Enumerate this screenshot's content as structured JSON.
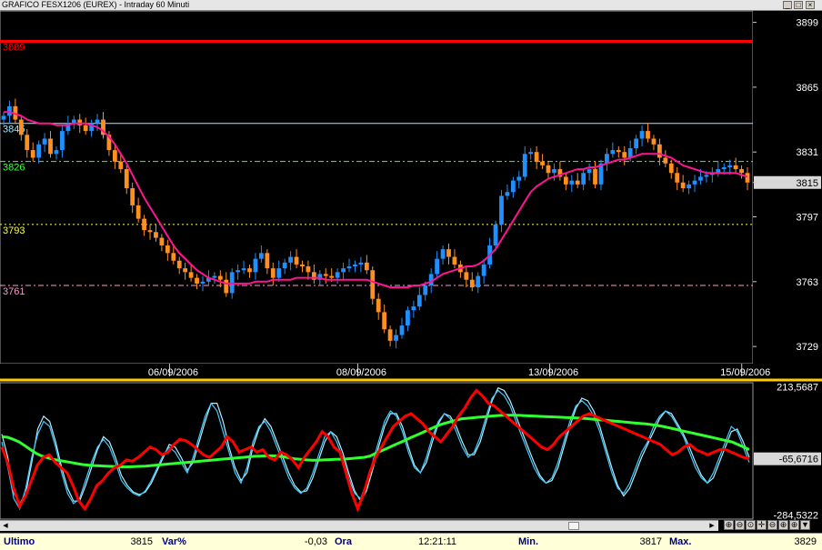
{
  "window": {
    "title": "GRAFICO FESX1206 (EUREX) - Intraday 60 Minuti",
    "controls": [
      "_",
      "□",
      "×"
    ]
  },
  "colors": {
    "background": "#000000",
    "up_candle": "#1e90ff",
    "down_candle": "#ff9020",
    "ma_line": "#ff1493",
    "resistance": "#ff0000",
    "level_cyan": "#9fe8ff",
    "level_green": "#40ff40",
    "level_yellow": "#ffff40",
    "level_pink": "#ff99cc",
    "osc_red": "#ff0000",
    "osc_green": "#30ff30",
    "osc_cyan": "#40c8ff",
    "osc_lightcyan": "#b0f0ff"
  },
  "chart_data": [
    {
      "type": "candlestick",
      "title": "",
      "ylim": [
        3720,
        3905
      ],
      "y_ticks": [
        "3899",
        "3865",
        "3831",
        "3815",
        "3797",
        "3763",
        "3729"
      ],
      "last_price_label": "3815",
      "x_labels": [
        "06/09/2006",
        "08/09/2006",
        "13/09/2006",
        "15/09/2006"
      ],
      "levels": [
        {
          "label": "3889",
          "value": 3889,
          "style": "solid",
          "color": "#ff0000"
        },
        {
          "label": "3845",
          "value": 3846,
          "style": "solid",
          "color": "#9fe8ff"
        },
        {
          "label": "3826",
          "value": 3826,
          "style": "dashdot",
          "color": "#40ff40"
        },
        {
          "label": "3793",
          "value": 3793,
          "style": "dotted",
          "color": "#ffff40"
        },
        {
          "label": "3761",
          "value": 3761,
          "style": "dashdot",
          "color": "#ff99cc"
        }
      ],
      "close": [
        3850,
        3855,
        3848,
        3840,
        3832,
        3828,
        3835,
        3838,
        3830,
        3832,
        3842,
        3846,
        3848,
        3845,
        3842,
        3846,
        3848,
        3840,
        3832,
        3826,
        3822,
        3812,
        3803,
        3796,
        3790,
        3789,
        3786,
        3782,
        3778,
        3774,
        3770,
        3768,
        3765,
        3762,
        3763,
        3765,
        3766,
        3764,
        3757,
        3768,
        3769,
        3770,
        3768,
        3775,
        3778,
        3770,
        3765,
        3770,
        3773,
        3776,
        3772,
        3771,
        3768,
        3764,
        3767,
        3766,
        3765,
        3768,
        3770,
        3771,
        3772,
        3773,
        3769,
        3754,
        3747,
        3738,
        3732,
        3735,
        3740,
        3748,
        3750,
        3756,
        3761,
        3767,
        3775,
        3780,
        3776,
        3772,
        3768,
        3764,
        3760,
        3766,
        3772,
        3782,
        3793,
        3808,
        3810,
        3816,
        3818,
        3830,
        3831,
        3826,
        3824,
        3820,
        3822,
        3818,
        3814,
        3816,
        3814,
        3820,
        3822,
        3814,
        3825,
        3830,
        3832,
        3831,
        3828,
        3833,
        3838,
        3842,
        3838,
        3835,
        3828,
        3825,
        3820,
        3815,
        3812,
        3814,
        3816,
        3818,
        3819,
        3820,
        3822,
        3823,
        3824,
        3822,
        3820,
        3815
      ],
      "ma": [
        3852,
        3852,
        3851,
        3850,
        3848,
        3847,
        3846,
        3846,
        3846,
        3845,
        3845,
        3845,
        3846,
        3846,
        3846,
        3845,
        3844,
        3842,
        3839,
        3835,
        3830,
        3825,
        3819,
        3813,
        3807,
        3802,
        3797,
        3792,
        3787,
        3782,
        3778,
        3775,
        3772,
        3769,
        3767,
        3765,
        3764,
        3763,
        3762,
        3762,
        3762,
        3762,
        3762,
        3763,
        3763,
        3763,
        3764,
        3764,
        3764,
        3764,
        3765,
        3765,
        3765,
        3765,
        3765,
        3764,
        3764,
        3764,
        3764,
        3764,
        3764,
        3764,
        3764,
        3763,
        3762,
        3761,
        3760,
        3760,
        3760,
        3760,
        3761,
        3761,
        3762,
        3763,
        3765,
        3767,
        3768,
        3769,
        3770,
        3771,
        3771,
        3772,
        3774,
        3777,
        3780,
        3785,
        3790,
        3795,
        3800,
        3805,
        3810,
        3813,
        3815,
        3817,
        3818,
        3819,
        3820,
        3821,
        3822,
        3822,
        3823,
        3823,
        3824,
        3825,
        3826,
        3827,
        3827,
        3828,
        3829,
        3830,
        3830,
        3830,
        3830,
        3829,
        3828,
        3826,
        3824,
        3823,
        3822,
        3821,
        3820,
        3820,
        3820,
        3820,
        3820,
        3820,
        3819,
        3818
      ]
    },
    {
      "type": "line",
      "title": "",
      "ylim": [
        -300,
        230
      ],
      "y_ticks": [
        "213,5687",
        "-65,6716",
        "-284,5322"
      ],
      "last_value_label": "-65,6716",
      "series": [
        {
          "color": "#ff0000",
          "values": [
            -20,
            -80,
            -180,
            -250,
            -210,
            -150,
            -90,
            -60,
            -50,
            -80,
            -100,
            -120,
            -170,
            -230,
            -260,
            -220,
            -170,
            -150,
            -120,
            -100,
            -90,
            -70,
            -75,
            -60,
            -40,
            -20,
            -30,
            -50,
            -40,
            -10,
            10,
            5,
            -10,
            -30,
            -50,
            -60,
            -40,
            -20,
            20,
            0,
            -40,
            -30,
            -20,
            -40,
            -30,
            -60,
            -70,
            -40,
            -50,
            -70,
            -100,
            -60,
            -30,
            0,
            40,
            20,
            -20,
            -40,
            -120,
            -200,
            -260,
            -200,
            -120,
            -60,
            -20,
            20,
            60,
            80,
            100,
            110,
            90,
            70,
            40,
            20,
            0,
            30,
            60,
            100,
            130,
            170,
            200,
            180,
            150,
            140,
            120,
            100,
            80,
            60,
            40,
            20,
            0,
            -20,
            -30,
            -10,
            20,
            40,
            60,
            80,
            100,
            110,
            100,
            90,
            80,
            70,
            60,
            50,
            40,
            30,
            20,
            10,
            0,
            -10,
            -30,
            -50,
            -40,
            -20,
            -10,
            -30,
            -40,
            -50,
            -40,
            -30,
            -30,
            -40,
            -50,
            -60,
            -65
          ]
        },
        {
          "color": "#30ff30",
          "values": [
            20,
            18,
            10,
            0,
            -15,
            -30,
            -45,
            -55,
            -62,
            -68,
            -72,
            -76,
            -80,
            -84,
            -88,
            -90,
            -92,
            -93,
            -94,
            -95,
            -96,
            -97,
            -97,
            -96,
            -95,
            -94,
            -92,
            -90,
            -88,
            -86,
            -84,
            -82,
            -80,
            -78,
            -76,
            -74,
            -72,
            -70,
            -68,
            -66,
            -64,
            -62,
            -60,
            -58,
            -56,
            -55,
            -54,
            -54,
            -55,
            -58,
            -62,
            -66,
            -68,
            -70,
            -71,
            -71,
            -70,
            -69,
            -68,
            -67,
            -66,
            -64,
            -62,
            -60,
            -55,
            -45,
            -35,
            -25,
            -15,
            -5,
            5,
            15,
            25,
            35,
            45,
            55,
            65,
            72,
            78,
            84,
            90,
            92,
            94,
            96,
            98,
            100,
            102,
            103,
            104,
            104,
            103,
            102,
            101,
            100,
            99,
            98,
            97,
            96,
            95,
            94,
            93,
            92,
            90,
            88,
            86,
            84,
            82,
            80,
            78,
            76,
            74,
            72,
            70,
            67,
            64,
            60,
            55,
            50,
            45,
            40,
            35,
            30,
            25,
            20,
            15,
            10,
            5,
            0,
            -10,
            -20,
            -30
          ]
        },
        {
          "color": "#40c8ff",
          "values": [
            0,
            -100,
            -220,
            -260,
            -180,
            -60,
            30,
            80,
            60,
            -20,
            -120,
            -200,
            -240,
            -220,
            -150,
            -80,
            -20,
            10,
            -20,
            -80,
            -150,
            -180,
            -200,
            -210,
            -190,
            -150,
            -100,
            -50,
            -20,
            -40,
            -80,
            -120,
            -60,
            20,
            100,
            150,
            120,
            40,
            -40,
            -120,
            -160,
            -100,
            0,
            60,
            80,
            40,
            -20,
            -80,
            -140,
            -180,
            -200,
            -180,
            -120,
            -50,
            20,
            40,
            0,
            -60,
            -140,
            -200,
            -220,
            -160,
            -80,
            0,
            80,
            120,
            100,
            40,
            -40,
            -100,
            -120,
            -60,
            20,
            80,
            110,
            90,
            40,
            -20,
            -60,
            -40,
            20,
            100,
            170,
            200,
            180,
            140,
            80,
            20,
            -40,
            -100,
            -140,
            -160,
            -140,
            -80,
            0,
            80,
            140,
            160,
            140,
            100,
            40,
            -40,
            -120,
            -180,
            -200,
            -160,
            -100,
            -40,
            0,
            60,
            100,
            120,
            100,
            60,
            20,
            -40,
            -100,
            -140,
            -160,
            -120,
            -60,
            0,
            60,
            40,
            -20,
            -80
          ]
        },
        {
          "color": "#b0f0ff",
          "values": [
            30,
            -60,
            -200,
            -240,
            -200,
            -80,
            50,
            100,
            80,
            0,
            -100,
            -180,
            -230,
            -230,
            -170,
            -100,
            -30,
            20,
            0,
            -60,
            -130,
            -170,
            -195,
            -205,
            -195,
            -160,
            -110,
            -60,
            -10,
            -20,
            -60,
            -110,
            -80,
            0,
            80,
            150,
            150,
            80,
            -20,
            -100,
            -150,
            -120,
            -20,
            50,
            90,
            60,
            0,
            -60,
            -120,
            -170,
            -195,
            -190,
            -140,
            -70,
            0,
            40,
            20,
            -40,
            -120,
            -190,
            -230,
            -190,
            -110,
            -20,
            60,
            110,
            110,
            60,
            -20,
            -90,
            -120,
            -80,
            0,
            70,
            110,
            100,
            60,
            0,
            -50,
            -50,
            0,
            80,
            160,
            210,
            200,
            160,
            100,
            40,
            -20,
            -80,
            -130,
            -160,
            -150,
            -100,
            -20,
            60,
            130,
            170,
            160,
            120,
            60,
            -20,
            -100,
            -170,
            -210,
            -180,
            -120,
            -60,
            -10,
            40,
            90,
            120,
            110,
            70,
            30,
            -20,
            -80,
            -130,
            -160,
            -140,
            -80,
            -20,
            40,
            50,
            0,
            -60
          ]
        }
      ]
    }
  ],
  "status": {
    "last_label": "Ultimo",
    "last_value": "3815",
    "var_label": "Var%",
    "var_value": "-0,03",
    "time_label": "Ora",
    "time_value": "12:21:11",
    "min_label": "Min.",
    "min_value": "3817",
    "max_label": "Max.",
    "max_value": "3829"
  },
  "toolbar": {
    "icons": [
      "⊕",
      "⊖",
      "⊙",
      "✛",
      "⊖",
      "⊕",
      "⊕",
      "▼"
    ]
  }
}
